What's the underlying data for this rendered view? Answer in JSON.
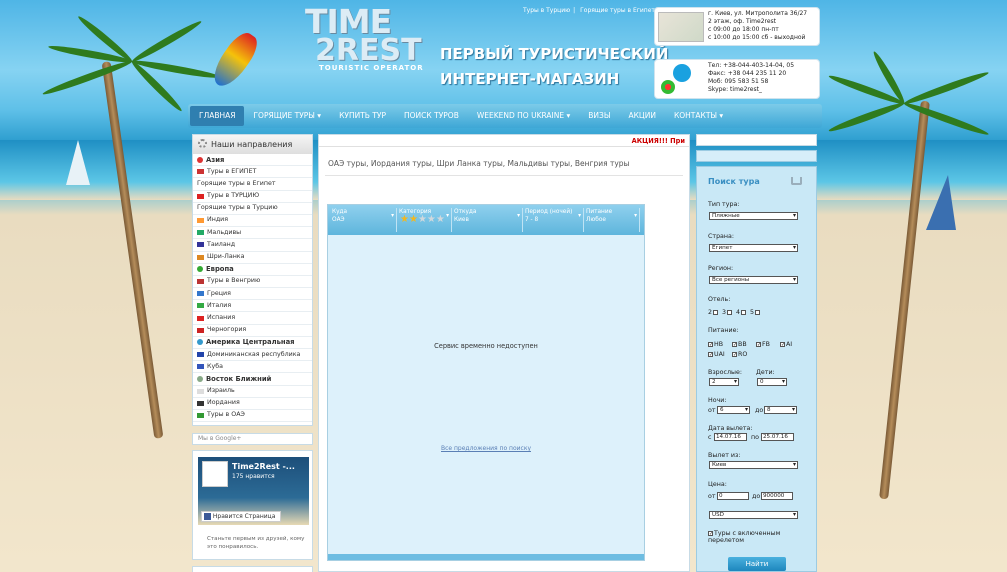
{
  "header": {
    "logo_line1": "TIME",
    "logo_line2": "2REST",
    "logo_line3": "TOURISTIC OPERATOR",
    "slogan_line1": "ПЕРВЫЙ ТУРИСТИЧЕСКИЙ",
    "slogan_line2": "ИНТЕРНЕТ-МАГАЗИН",
    "top_link1": "Туры в Турцию",
    "top_link2": "Горящие туры в Египет",
    "address_lines": [
      "г. Киев, ул. Митрополита 36/27",
      "2 этаж, оф. Time2rest",
      "с 09:00 до 18:00 пн-пт",
      "с 10:00 до 15:00 сб - выходной"
    ],
    "phone_lines": [
      "Тел: +38-044-403-14-04, 05",
      "Факс: +38 044 235 11 20",
      "Моб: 095 583 51 58",
      "Skype: time2rest_"
    ]
  },
  "nav": {
    "items": [
      "ГЛАВНАЯ",
      "ГОРЯЩИЕ ТУРЫ ▾",
      "КУПИТЬ ТУР",
      "ПОИСК ТУРОВ",
      "WEEKEND ПО UKRAINE ▾",
      "ВИЗЫ",
      "АКЦИИ",
      "КОНТАКТЫ ▾"
    ]
  },
  "left": {
    "title": "Наши направления",
    "items": [
      {
        "label": "Азия",
        "cat": true,
        "c": "#d33"
      },
      {
        "label": "Туры в ЕГИПЕТ",
        "c": "#c33"
      },
      {
        "label": "Горящие туры в Египет",
        "c": ""
      },
      {
        "label": "Туры в ТУРЦИЮ",
        "c": "#d22"
      },
      {
        "label": "Горящие туры в Турцию",
        "c": ""
      },
      {
        "label": "Индия",
        "c": "#f93"
      },
      {
        "label": "Мальдивы",
        "c": "#2a6"
      },
      {
        "label": "Таиланд",
        "c": "#339"
      },
      {
        "label": "Шри-Ланка",
        "c": "#d82"
      },
      {
        "label": "Европа",
        "cat": true,
        "c": "#3a3"
      },
      {
        "label": "Туры в Венгрию",
        "c": "#b33"
      },
      {
        "label": "Греция",
        "c": "#37c"
      },
      {
        "label": "Италия",
        "c": "#3a4"
      },
      {
        "label": "Испания",
        "c": "#d22"
      },
      {
        "label": "Черногория",
        "c": "#c22"
      },
      {
        "label": "Америка Центральная",
        "cat": true,
        "c": "#39c"
      },
      {
        "label": "Доминиканская республика",
        "c": "#24a"
      },
      {
        "label": "Куба",
        "c": "#35b"
      },
      {
        "label": "Восток Ближний",
        "cat": true,
        "c": "#8a8"
      },
      {
        "label": "Израиль",
        "c": "#ddd"
      },
      {
        "label": "Иордания",
        "c": "#333"
      },
      {
        "label": "Туры в ОАЭ",
        "c": "#393"
      }
    ],
    "partner_label": "Мы в Google+",
    "fb_name": "Time2Rest -...",
    "fb_likes": "175 нравится",
    "fb_like_button": "Нравится Страница",
    "fb_note": "Станьте первым из друзей, кому это понравилось."
  },
  "center": {
    "promo": "АКЦИЯ!!! При",
    "title": "ОАЭ туры, Иордания туры, Шри Ланка туры, Мальдивы туры, Венгрия туры",
    "filters": [
      {
        "label": "Куда",
        "value": "ОАЭ"
      },
      {
        "label": "Категория",
        "value": ""
      },
      {
        "label": "Откуда",
        "value": "Киев"
      },
      {
        "label": "Период (ночей)",
        "value": "7 - 8"
      },
      {
        "label": "Питание",
        "value": "Любое"
      }
    ],
    "stars": 2,
    "unavailable": "Сервис временно недоступен",
    "link": "Все предложения по поиску"
  },
  "form": {
    "title": "Поиск тура",
    "tour_type_label": "Тип тура:",
    "tour_type": "Пляжные",
    "country_label": "Страна:",
    "country": "Египет",
    "region_label": "Регион:",
    "region": "Все регионы",
    "hotel_label": "Отель:",
    "hotel_opts": [
      "2",
      "3",
      "4",
      "5"
    ],
    "meal_label": "Питание:",
    "meal_opts": [
      "HB",
      "BB",
      "FB",
      "AI",
      "UAI",
      "RO"
    ],
    "adults_label": "Взрослые:",
    "adults": "2",
    "kids_label": "Дети:",
    "kids": "0",
    "nights_label": "Ночи:",
    "nights_from_prefix": "от",
    "nights_from": "6",
    "nights_to_prefix": "до",
    "nights_to": "8",
    "date_label": "Дата вылета:",
    "date_from_prefix": "с",
    "date_from": "14.07.16",
    "date_to_prefix": "по",
    "date_to": "25.07.16",
    "depart_label": "Вылет из:",
    "depart": "Киев",
    "price_label": "Цена:",
    "price_from_prefix": "от",
    "price_from": "0",
    "price_to_prefix": "до",
    "price_to": "900000",
    "currency": "USD",
    "included_label": "Туры с включенным перелетом",
    "search_button": "Найти"
  }
}
